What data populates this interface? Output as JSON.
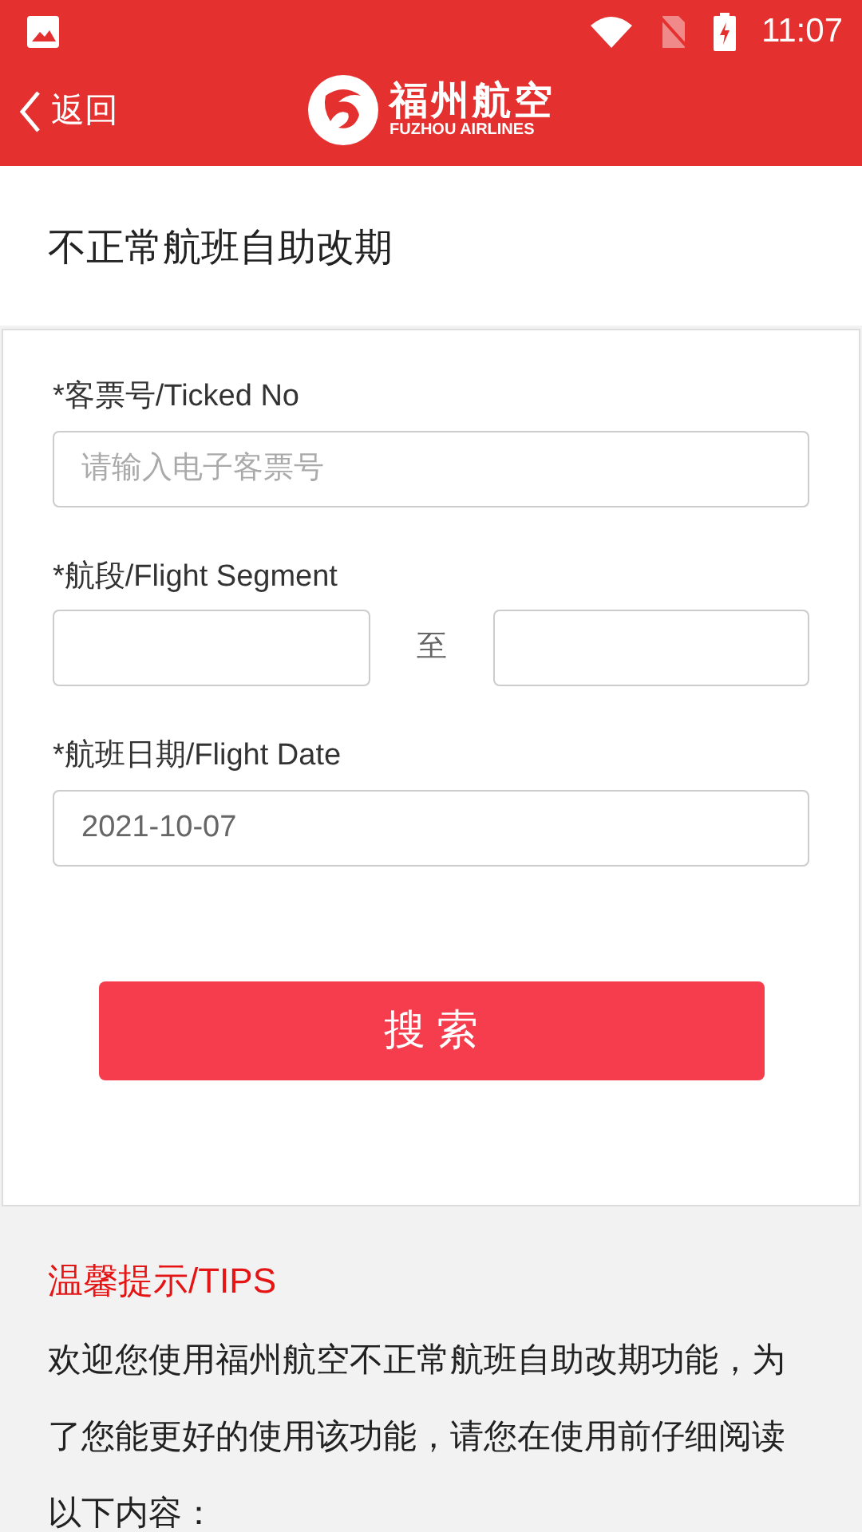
{
  "status_bar": {
    "time": "11:07"
  },
  "header": {
    "back": "返回",
    "logo_cn": "福州航空",
    "logo_en": "FUZHOU AIRLINES"
  },
  "page_title": "不正常航班自助改期",
  "form": {
    "fields": [
      {
        "kind": "single",
        "label": "*客票号/Ticked No",
        "placeholder": "请输入电子客票号"
      },
      {
        "kind": "range",
        "label": "*航段/Flight Segment",
        "separator": "至"
      },
      {
        "kind": "single",
        "label": "*航班日期/Flight Date",
        "value": "2021-10-07"
      }
    ],
    "button": "搜 索"
  },
  "tips": {
    "title": "温馨提示/TIPS",
    "text": "欢迎您使用福州航空不正常航班自助改期功能，为了您能更好的使用该功能，请您在使用前仔细阅读以下内容："
  }
}
